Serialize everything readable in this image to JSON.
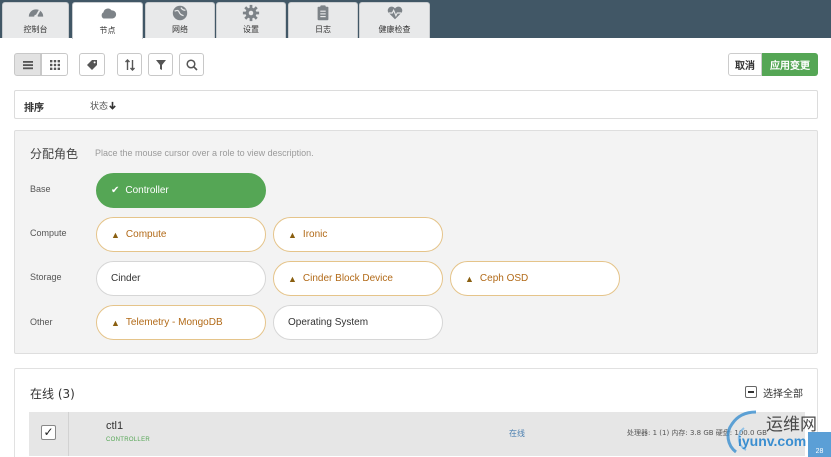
{
  "nav": {
    "tabs": [
      {
        "label": "控制台",
        "icon": "dashboard-icon"
      },
      {
        "label": "节点",
        "icon": "cloud-icon",
        "active": true
      },
      {
        "label": "网络",
        "icon": "globe-icon"
      },
      {
        "label": "设置",
        "icon": "gear-icon"
      },
      {
        "label": "日志",
        "icon": "clipboard-icon"
      },
      {
        "label": "健康检查",
        "icon": "heartbeat-icon"
      }
    ]
  },
  "toolbar": {
    "view_list_icon": "list-view-icon",
    "view_grid_icon": "grid-view-icon",
    "labels_icon": "tag-icon",
    "sort_icon": "sort-icon",
    "filter_icon": "filter-icon",
    "search_icon": "search-icon",
    "cancel_label": "取消",
    "apply_label": "应用变更"
  },
  "sort": {
    "label": "排序",
    "field": "状态",
    "direction_icon": "arrow-down-icon"
  },
  "roles": {
    "title": "分配角色",
    "hint": "Place the mouse cursor over a role to view description.",
    "groups": [
      {
        "label": "Base",
        "roles": [
          {
            "name": "Controller",
            "state": "selected"
          }
        ]
      },
      {
        "label": "Compute",
        "roles": [
          {
            "name": "Compute",
            "state": "warning"
          },
          {
            "name": "Ironic",
            "state": "warning"
          }
        ]
      },
      {
        "label": "Storage",
        "roles": [
          {
            "name": "Cinder",
            "state": "normal"
          },
          {
            "name": "Cinder Block Device",
            "state": "warning"
          },
          {
            "name": "Ceph OSD",
            "state": "warning"
          }
        ]
      },
      {
        "label": "Other",
        "roles": [
          {
            "name": "Telemetry - MongoDB",
            "state": "warning"
          },
          {
            "name": "Operating System",
            "state": "normal"
          }
        ]
      }
    ]
  },
  "online": {
    "title": "在线 (3)",
    "select_all_label": "选择全部",
    "nodes": [
      {
        "name": "ctl1",
        "role": "CONTROLLER",
        "status": "在线",
        "specs": "处理器: 1 (1)  内存: 3.8 GB  硬盘: 100.0 GB",
        "checked": true
      }
    ]
  },
  "watermark": {
    "line1": "运维网",
    "line2": "iyunv.com",
    "badge": "28"
  },
  "colors": {
    "nav_bg": "#415766",
    "accent_green": "#55a655",
    "warning_orange": "#b26a18"
  }
}
